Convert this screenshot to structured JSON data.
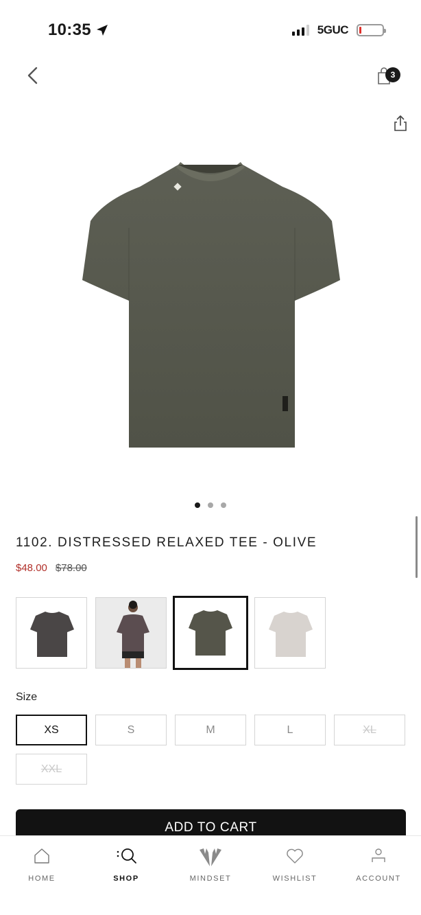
{
  "status_bar": {
    "time": "10:35",
    "network": "5GUC",
    "icons": [
      "location-arrow-icon",
      "signal-icon",
      "battery-icon"
    ]
  },
  "header": {
    "back_icon": "chevron-left-icon",
    "cart_icon": "shopping-bag-icon",
    "cart_count": "3",
    "share_icon": "share-icon"
  },
  "gallery": {
    "image_count": 3,
    "active_index": 0
  },
  "product": {
    "title": "1102. DISTRESSED RELAXED TEE - OLIVE",
    "sale_price": "$48.00",
    "original_price": "$78.00",
    "colors": [
      {
        "name": "charcoal",
        "color": "#4a4646",
        "type": "flat",
        "selected": false
      },
      {
        "name": "charcoal-model",
        "color": "#5b4d50",
        "type": "model",
        "selected": false
      },
      {
        "name": "olive",
        "color": "#55554a",
        "type": "flat",
        "selected": true
      },
      {
        "name": "stone",
        "color": "#d8d3cf",
        "type": "flat",
        "selected": false
      }
    ],
    "colors_product_main": "#585a4f",
    "brand_sale_color": "#b1302a"
  },
  "sizes": {
    "label": "Size",
    "options": [
      {
        "label": "XS",
        "state": "selected"
      },
      {
        "label": "S",
        "state": "available"
      },
      {
        "label": "M",
        "state": "available"
      },
      {
        "label": "L",
        "state": "available"
      },
      {
        "label": "XL",
        "state": "unavailable"
      },
      {
        "label": "XXL",
        "state": "unavailable"
      }
    ]
  },
  "cta": {
    "add_to_cart": "ADD TO CART"
  },
  "tabbar": {
    "tabs": [
      {
        "label": "HOME",
        "icon": "home-icon",
        "active": false
      },
      {
        "label": "SHOP",
        "icon": "search-icon",
        "active": true
      },
      {
        "label": "MINDSET",
        "icon": "wings-logo-icon",
        "active": false
      },
      {
        "label": "WISHLIST",
        "icon": "heart-icon",
        "active": false
      },
      {
        "label": "ACCOUNT",
        "icon": "user-icon",
        "active": false
      }
    ]
  }
}
